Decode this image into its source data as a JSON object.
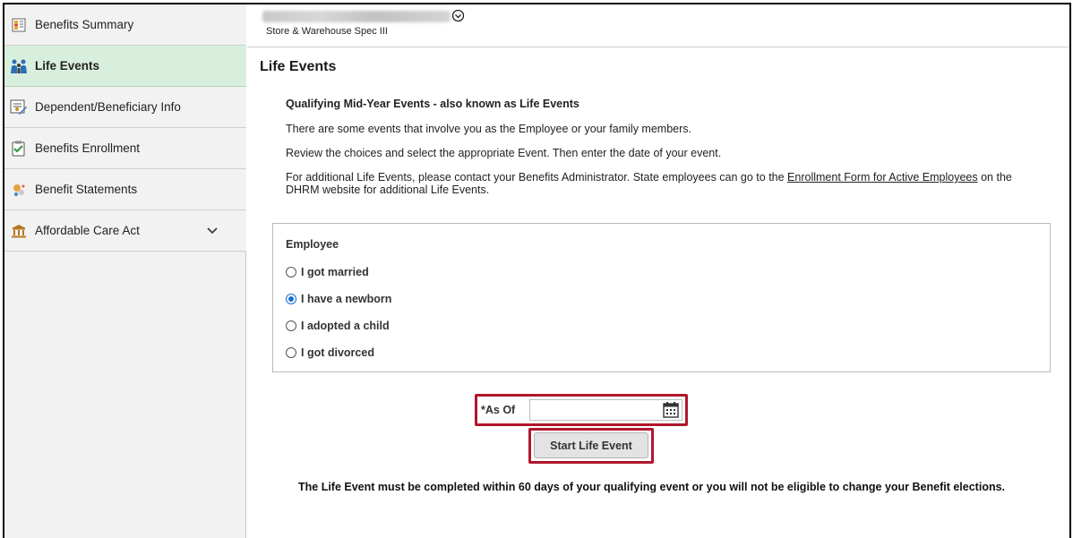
{
  "sidebar": {
    "items": [
      {
        "label": "Benefits Summary",
        "icon": "benefits-summary-icon"
      },
      {
        "label": "Life Events",
        "icon": "family-icon",
        "active": true
      },
      {
        "label": "Dependent/Beneficiary Info",
        "icon": "dependent-info-icon"
      },
      {
        "label": "Benefits Enrollment",
        "icon": "enrollment-check-icon"
      },
      {
        "label": "Benefit Statements",
        "icon": "statements-icon"
      },
      {
        "label": "Affordable Care Act",
        "icon": "building-icon",
        "expandable": true
      }
    ]
  },
  "header": {
    "employee_title": "Store & Warehouse Spec III"
  },
  "page": {
    "title": "Life Events",
    "intro_heading": "Qualifying Mid-Year Events - also known as Life Events",
    "intro_p1": "There are some events that involve you as the Employee or your family members.",
    "intro_p2": "Review the choices and select the appropriate Event. Then enter the date of your event.",
    "intro_p3_before": "For additional Life Events, please contact your Benefits Administrator. State employees can go to the ",
    "intro_p3_link": "Enrollment Form for Active Employees",
    "intro_p3_after": " on the DHRM website for additional Life Events."
  },
  "employee_group": {
    "title": "Employee",
    "options": [
      {
        "label": "I got married",
        "checked": false
      },
      {
        "label": "I have a newborn",
        "checked": true
      },
      {
        "label": "I adopted a child",
        "checked": false
      },
      {
        "label": "I got divorced",
        "checked": false
      }
    ]
  },
  "as_of": {
    "label": "*As Of",
    "value": ""
  },
  "start_button": "Start Life Event",
  "footer_note": "The Life Event must be completed within 60 days of your qualifying event or you will not be eligible to change your Benefit elections.",
  "colors": {
    "active_bg": "#d9efdd",
    "highlight": "#b0172c",
    "radio_selected": "#1a6fd1"
  }
}
